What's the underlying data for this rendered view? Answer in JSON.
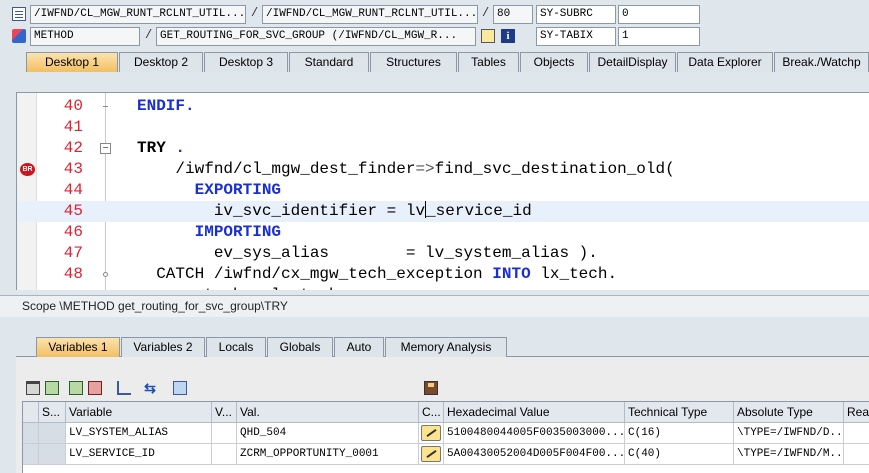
{
  "header": {
    "row1": {
      "program": "/IWFND/CL_MGW_RUNT_RCLNT_UTIL...",
      "include": "/IWFND/CL_MGW_RUNT_RCLNT_UTIL...",
      "line": "80",
      "var_name": "SY-SUBRC",
      "var_value": "0",
      "icon": "program-icon"
    },
    "row2": {
      "event_type": "METHOD",
      "event": "GET_ROUTING_FOR_SVC_GROUP (/IWFND/CL_MGW_R...",
      "var_name": "SY-TABIX",
      "var_value": "1",
      "icons": [
        "method-icon",
        "navigate-icon",
        "info-icon"
      ]
    },
    "separator": "/"
  },
  "top_tabs": [
    "Desktop 1",
    "Desktop 2",
    "Desktop 3",
    "Standard",
    "Structures",
    "Tables",
    "Objects",
    "DetailDisplay",
    "Data Explorer",
    "Break./Watchp"
  ],
  "top_tabs_active": "Desktop 1",
  "editor": {
    "lines": [
      {
        "n": "40",
        "parts": [
          {
            "t": "ENDIF.",
            "c": "kw"
          }
        ]
      },
      {
        "n": "41",
        "parts": []
      },
      {
        "n": "42",
        "parts": [
          {
            "t": "TRY",
            "c": "kwb"
          },
          {
            "t": " .",
            "c": "kw"
          }
        ]
      },
      {
        "n": "43",
        "parts": [
          {
            "t": "    /iwfnd/cl_mgw_dest_finder",
            "c": ""
          },
          {
            "t": "=>",
            "c": "op"
          },
          {
            "t": "find_svc_destination_old(",
            "c": ""
          }
        ]
      },
      {
        "n": "44",
        "parts": [
          {
            "t": "      EXPORTING",
            "c": "kw"
          }
        ]
      },
      {
        "n": "45",
        "parts": [
          {
            "t": "        iv_svc_identifier = lv",
            "c": ""
          },
          {
            "t": "|",
            "c": "caret"
          },
          {
            "t": "_service_id",
            "c": ""
          }
        ]
      },
      {
        "n": "46",
        "parts": [
          {
            "t": "      IMPORTING",
            "c": "kw"
          }
        ]
      },
      {
        "n": "47",
        "parts": [
          {
            "t": "        ev_sys_alias        = lv_system_alias ).",
            "c": ""
          }
        ]
      },
      {
        "n": "48",
        "parts": [
          {
            "t": "  CATCH /iwfnd/cx_mgw_tech_exception ",
            "c": ""
          },
          {
            "t": "INTO",
            "c": "kw"
          },
          {
            "t": " lx_tech.",
            "c": ""
          }
        ]
      },
      {
        "n": "",
        "parts": [
          {
            "t": "    ev_tech = lx_tech.",
            "c": ""
          }
        ]
      }
    ],
    "current_line": "45",
    "breakpoint_line": "43",
    "breakpoint_icon": "breakpoint-icon"
  },
  "scope_text": "Scope \\METHOD get_routing_for_svc_group\\TRY",
  "lower_tabs": [
    "Variables 1",
    "Variables 2",
    "Locals",
    "Globals",
    "Auto",
    "Memory Analysis"
  ],
  "lower_tabs_active": "Variables 1",
  "toolbar_icons": [
    "delete-icon",
    "insert-icon",
    "save-variant-icon",
    "load-variant-icon",
    "hierarchy-icon",
    "navigate-arrows-icon",
    "folder-icon",
    "save-icon"
  ],
  "grid": {
    "columns": [
      "S...",
      "Variable",
      "V...",
      "Val.",
      "C...",
      "Hexadecimal Value",
      "Technical Type",
      "Absolute Type",
      "Read"
    ],
    "rows": [
      {
        "variable": "LV_SYSTEM_ALIAS",
        "v": "",
        "value": "QHD_504",
        "hex": "5100480044005F0035003000...",
        "tech": "C(16)",
        "abs": "\\TYPE=/IWFND/D..."
      },
      {
        "variable": "LV_SERVICE_ID",
        "v": "",
        "value": "ZCRM_OPPORTUNITY_0001",
        "hex": "5A00430052004D005F004F00...",
        "tech": "C(40)",
        "abs": "\\TYPE=/IWFND/M..."
      }
    ],
    "edit_icon": "pencil-icon"
  }
}
